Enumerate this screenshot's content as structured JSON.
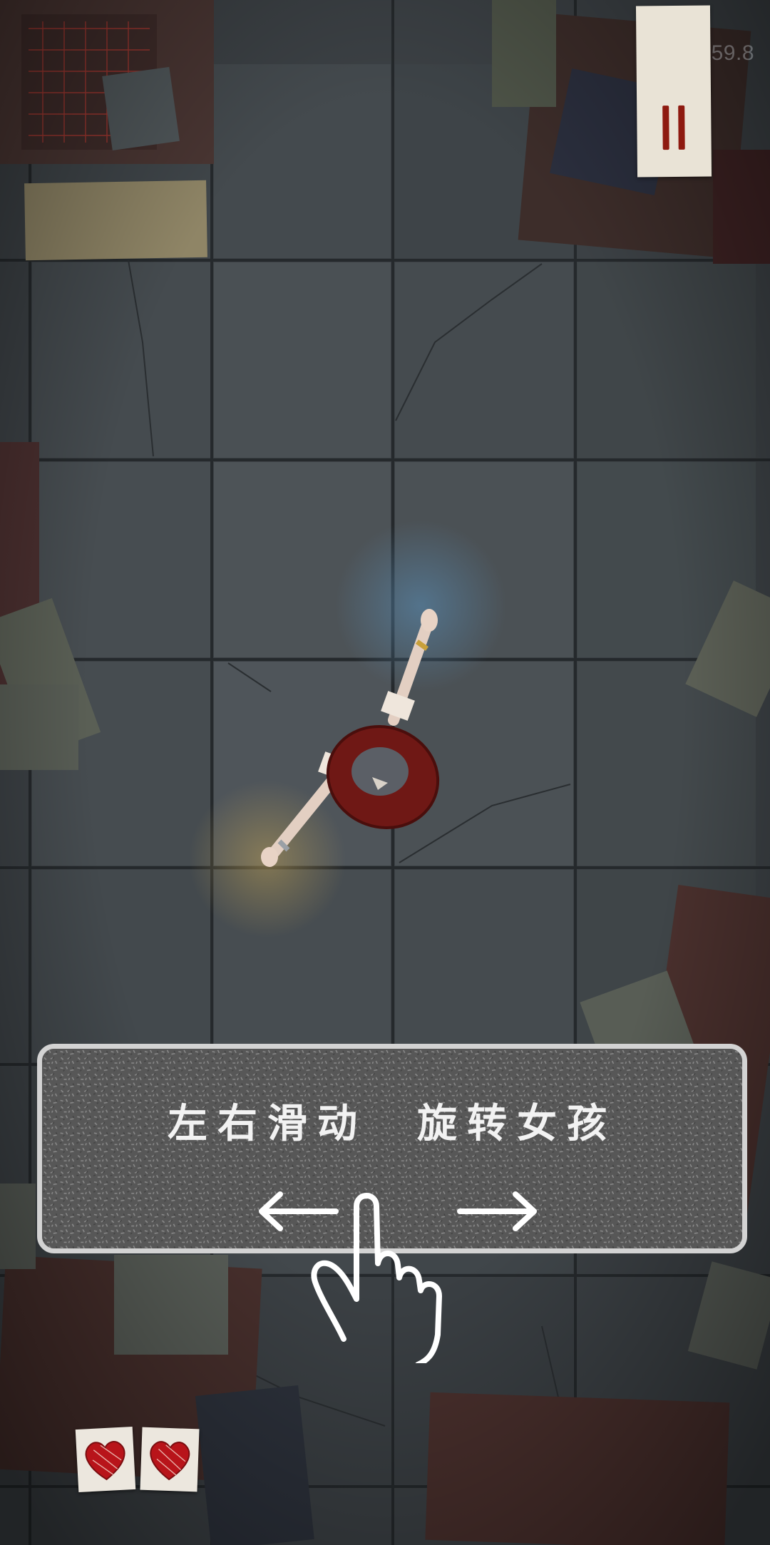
{
  "hud": {
    "fps_text": "FPS: 59.8",
    "pause_icon": "pause-icon"
  },
  "tutorial": {
    "instruction_text": "左右滑动　旋转女孩",
    "left_arrow_icon": "arrow-left-icon",
    "right_arrow_icon": "arrow-right-icon",
    "hand_icon": "swipe-hand-icon"
  },
  "lives": {
    "count": 2,
    "icon": "heart-icon",
    "heart_color": "#b8141a"
  },
  "colors": {
    "floor": "#3f4448",
    "pause_bar": "#8e1a10",
    "girl_skirt": "#7a1a17",
    "panel_border": "#d3d3d3"
  }
}
